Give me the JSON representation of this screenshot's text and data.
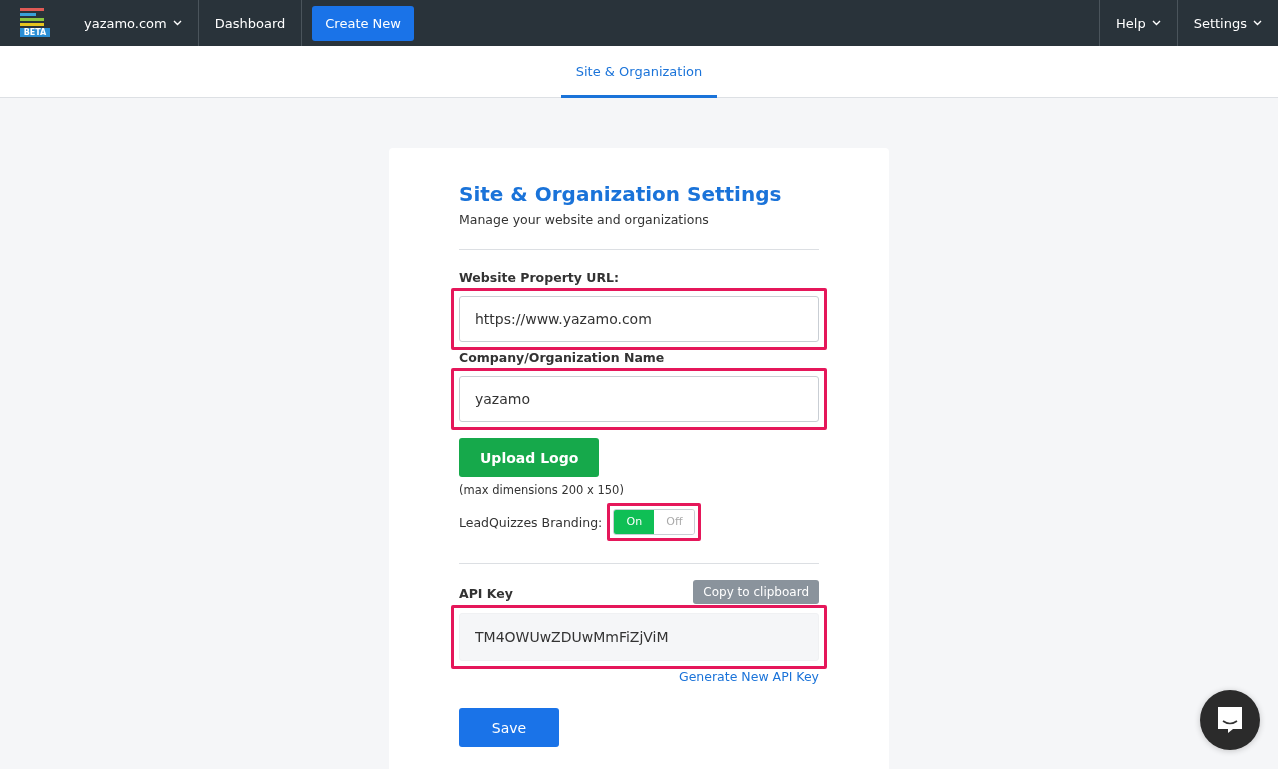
{
  "navbar": {
    "logo_badge": "BETA",
    "site_menu": "yazamo.com",
    "links": [
      {
        "label": "Dashboard"
      }
    ],
    "create_button": "Create New",
    "right_menus": [
      {
        "label": "Help"
      },
      {
        "label": "Settings"
      }
    ]
  },
  "tabs": [
    {
      "label": "Site & Organization",
      "selected": true
    }
  ],
  "settings": {
    "title": "Site & Organization Settings",
    "subtitle": "Manage your website and organizations",
    "fields": [
      {
        "label": "Website Property URL:",
        "value": "https://www.yazamo.com",
        "highlighted": true
      },
      {
        "label": "Company/Organization Name",
        "value": "yazamo",
        "highlighted": true
      }
    ],
    "upload_button": "Upload Logo",
    "upload_note": "(max dimensions 200 x 150)",
    "branding": {
      "label": "LeadQuizzes Branding:",
      "highlighted": true,
      "options": [
        {
          "label": "On",
          "selected": true
        },
        {
          "label": "Off",
          "selected": false
        }
      ]
    },
    "api_key": {
      "label": "API Key",
      "copy_button": "Copy to clipboard",
      "value": "TM4OWUwZDUwMmFiZjViM",
      "highlighted": true,
      "generate_link": "Generate New API Key"
    },
    "save_button": "Save"
  }
}
